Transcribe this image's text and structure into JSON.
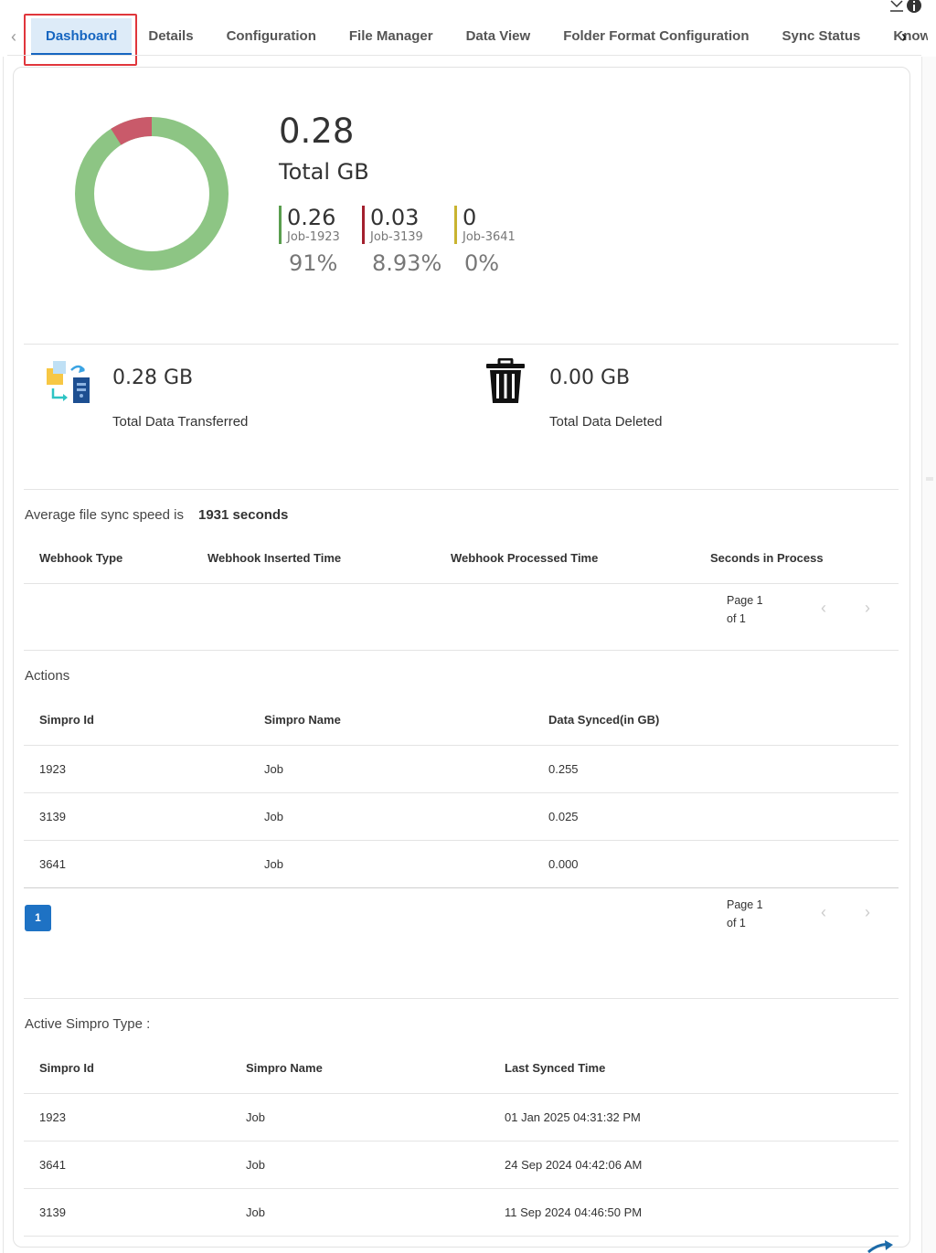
{
  "tabs": [
    {
      "label": "Dashboard",
      "active": true
    },
    {
      "label": "Details"
    },
    {
      "label": "Configuration"
    },
    {
      "label": "File Manager"
    },
    {
      "label": "Data View"
    },
    {
      "label": "Folder Format Configuration"
    },
    {
      "label": "Sync Status"
    },
    {
      "label": "Know"
    }
  ],
  "summary": {
    "total_value": "0.28",
    "total_label": "Total GB",
    "jobs": [
      {
        "value": "0.26",
        "name": "Job-1923",
        "percent": "91%",
        "color": "#5a9e4e"
      },
      {
        "value": "0.03",
        "name": "Job-3139",
        "percent": "8.93%",
        "color": "#a3202e"
      },
      {
        "value": "0",
        "name": "Job-3641",
        "percent": "0%",
        "color": "#c9b430"
      }
    ],
    "donut_colors": {
      "main": "#8dc584",
      "slice": "#c95a6a"
    }
  },
  "stats": {
    "transferred_value": "0.28 GB",
    "transferred_label": "Total Data Transferred",
    "deleted_value": "0.00 GB",
    "deleted_label": "Total Data Deleted"
  },
  "sync_speed": {
    "label": "Average file sync speed is",
    "value": "1931 seconds"
  },
  "webhook_table": {
    "headers": [
      "Webhook Type",
      "Webhook Inserted Time",
      "Webhook Processed Time",
      "Seconds in Process"
    ],
    "pager_line1": "Page 1",
    "pager_line2": "of 1"
  },
  "actions": {
    "title": "Actions",
    "headers": [
      "Simpro Id",
      "Simpro Name",
      "Data Synced(in GB)"
    ],
    "rows": [
      [
        "1923",
        "Job",
        "0.255"
      ],
      [
        "3139",
        "Job",
        "0.025"
      ],
      [
        "3641",
        "Job",
        "0.000"
      ]
    ],
    "page_button": "1",
    "pager_line1": "Page 1",
    "pager_line2": "of 1"
  },
  "active_types": {
    "title": "Active Simpro Type :",
    "headers": [
      "Simpro Id",
      "Simpro Name",
      "Last Synced Time"
    ],
    "rows": [
      [
        "1923",
        "Job",
        "01 Jan 2025 04:31:32 PM"
      ],
      [
        "3641",
        "Job",
        "24 Sep 2024 04:42:06 AM"
      ],
      [
        "3139",
        "Job",
        "11 Sep 2024 04:46:50 PM"
      ]
    ]
  }
}
